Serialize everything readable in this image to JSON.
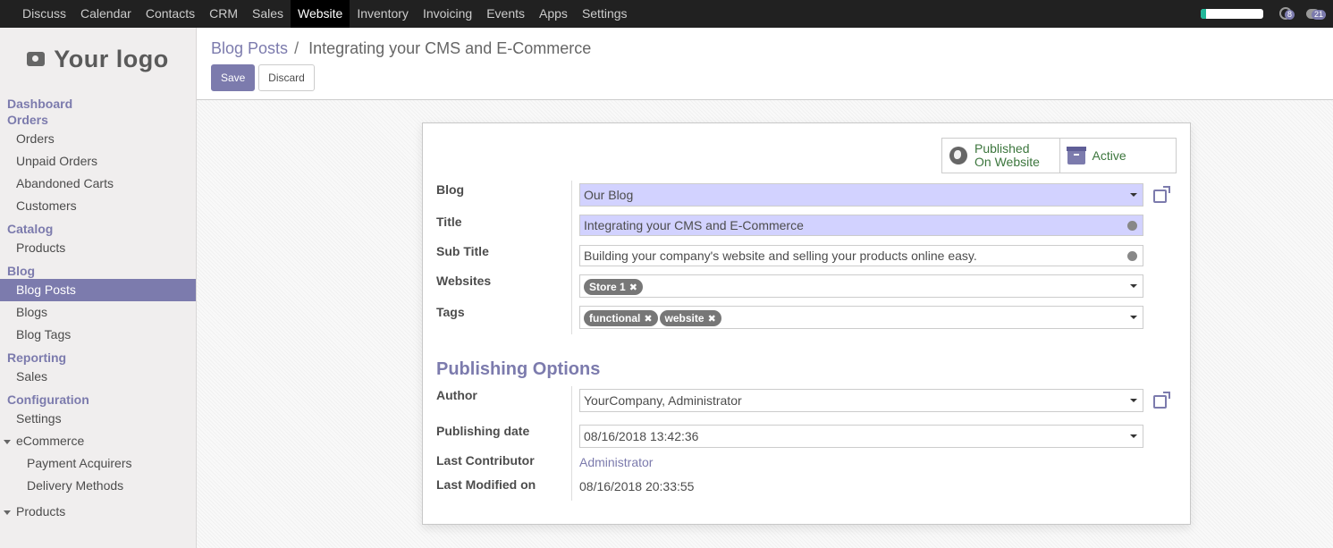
{
  "topbar": {
    "menus": [
      "Discuss",
      "Calendar",
      "Contacts",
      "CRM",
      "Sales",
      "Website",
      "Inventory",
      "Invoicing",
      "Events",
      "Apps",
      "Settings"
    ],
    "active_menu": "Website",
    "progress": 0.08,
    "activity_count": "8",
    "messages_count": "21"
  },
  "sidebar": {
    "logo_text": "Your logo",
    "dashboard": "Dashboard",
    "orders_section": "Orders",
    "orders_items": [
      "Orders",
      "Unpaid Orders",
      "Abandoned Carts",
      "Customers"
    ],
    "catalog_section": "Catalog",
    "catalog_items": [
      "Products"
    ],
    "blog_section": "Blog",
    "blog_items": [
      "Blog Posts",
      "Blogs",
      "Blog Tags"
    ],
    "reporting_section": "Reporting",
    "reporting_items": [
      "Sales"
    ],
    "configuration_section": "Configuration",
    "configuration_items": [
      "Settings"
    ],
    "ecommerce_toggle": "eCommerce",
    "ecommerce_items": [
      "Payment Acquirers",
      "Delivery Methods"
    ],
    "products_toggle": "Products"
  },
  "control_panel": {
    "breadcrumb_parent": "Blog Posts",
    "breadcrumb_separator": "/",
    "breadcrumb_current": "Integrating your CMS and E-Commerce",
    "save_label": "Save",
    "discard_label": "Discard"
  },
  "form": {
    "smart_buttons": {
      "published_line1": "Published",
      "published_line2": "On Website",
      "active_label": "Active"
    },
    "blog_label": "Blog",
    "blog_value": "Our Blog",
    "title_label": "Title",
    "title_value": "Integrating your CMS and E-Commerce",
    "subtitle_label": "Sub Title",
    "subtitle_value": "Building your company's website and selling your products online easy.",
    "websites_label": "Websites",
    "websites_tags": [
      "Store 1"
    ],
    "tags_label": "Tags",
    "tags": [
      "functional",
      "website"
    ],
    "publishing_title": "Publishing Options",
    "author_label": "Author",
    "author_value": "YourCompany, Administrator",
    "pubdate_label": "Publishing date",
    "pubdate_value": "08/16/2018 13:42:36",
    "contributor_label": "Last Contributor",
    "contributor_value": "Administrator",
    "modified_label": "Last Modified on",
    "modified_value": "08/16/2018 20:33:55"
  },
  "colors": {
    "brand": "#7c7bad",
    "topbar": "#212121",
    "required_field": "#d2d2ff",
    "published_text": "#3c763d"
  }
}
